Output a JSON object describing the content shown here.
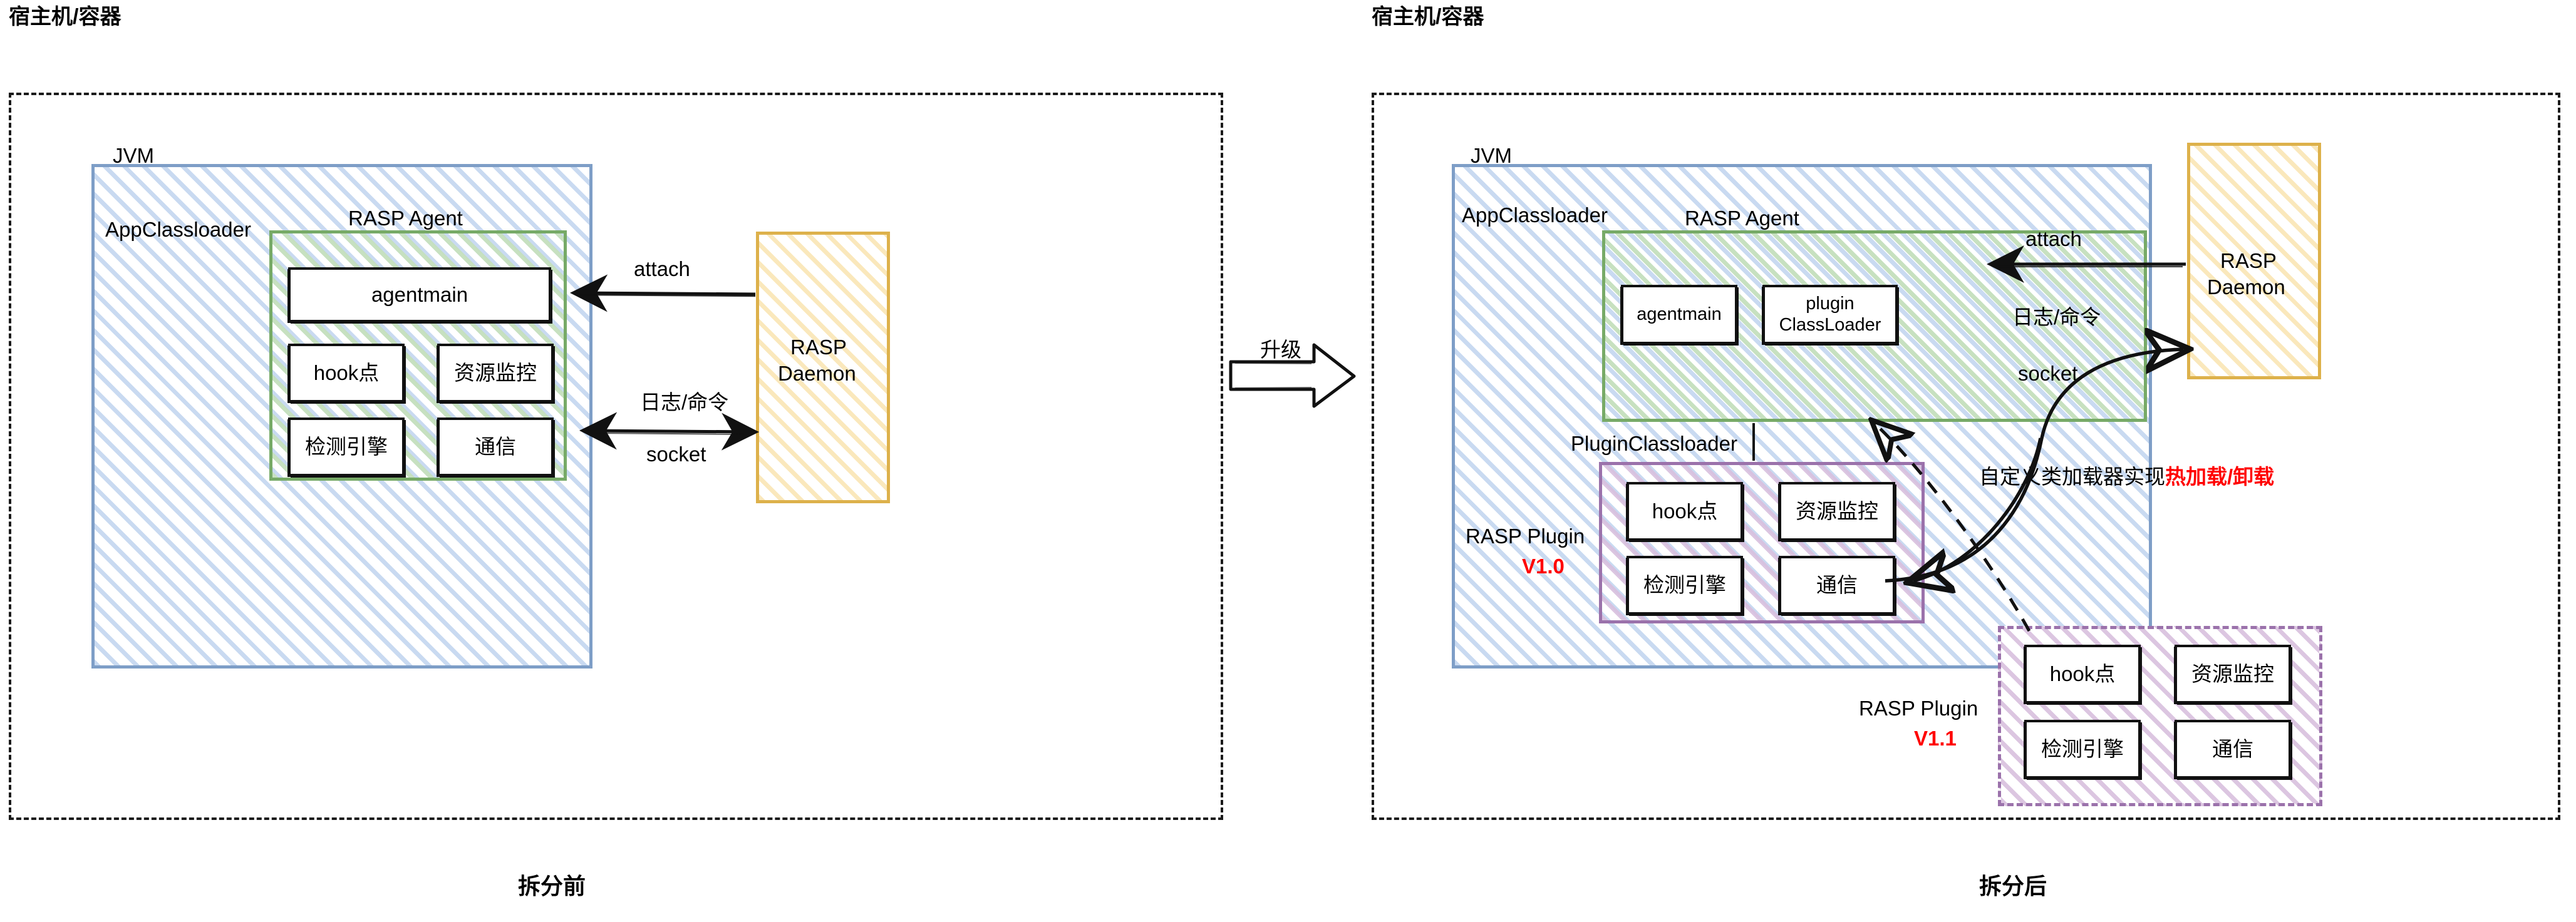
{
  "diagram": {
    "title_left": "宿主机/容器",
    "title_right": "宿主机/容器",
    "caption_left": "拆分前",
    "caption_right": "拆分后",
    "transition_label": "升级"
  },
  "left": {
    "host_label": "宿主机/容器",
    "jvm_label": "JVM",
    "appclassloader_label": "AppClassloader",
    "rasp_agent_label": "RASP Agent",
    "agent_nodes": [
      {
        "label": "agentmain"
      },
      {
        "label": "hook点"
      },
      {
        "label": "资源监控"
      },
      {
        "label": "检测引擎"
      },
      {
        "label": "通信"
      }
    ],
    "daemon_label": "RASP\nDaemon",
    "daemon_line1": "RASP",
    "daemon_line2": "Daemon",
    "arrow_attach": "attach",
    "arrow_log_cmd": "日志/命令",
    "arrow_socket": "socket",
    "caption": "拆分前"
  },
  "right": {
    "host_label": "宿主机/容器",
    "jvm_label": "JVM",
    "appclassloader_label": "AppClassloader",
    "rasp_agent_label": "RASP Agent",
    "agent_nodes": [
      {
        "label": "agentmain"
      },
      {
        "label": "plugin\nClassLoader",
        "line1": "plugin",
        "line2": "ClassLoader"
      }
    ],
    "pluginclassloader_label": "PluginClassloader",
    "plugin_v10_name": "RASP Plugin",
    "plugin_v10_version": "V1.0",
    "plugin_v10_nodes": [
      {
        "label": "hook点"
      },
      {
        "label": "资源监控"
      },
      {
        "label": "检测引擎"
      },
      {
        "label": "通信"
      }
    ],
    "plugin_v11_name": "RASP Plugin",
    "plugin_v11_version": "V1.1",
    "plugin_v11_nodes": [
      {
        "label": "hook点"
      },
      {
        "label": "资源监控"
      },
      {
        "label": "检测引擎"
      },
      {
        "label": "通信"
      }
    ],
    "daemon_line1": "RASP",
    "daemon_line2": "Daemon",
    "arrow_attach": "attach",
    "arrow_log_cmd": "日志/命令",
    "arrow_socket": "socket",
    "note_black": "自定义类加载器实现",
    "note_red": "热加载/卸载",
    "caption": "拆分后"
  },
  "colors": {
    "jvm_border": "#7e9ec7",
    "agent_border": "#77aa67",
    "plugin_border": "#9b72ab",
    "daemon_border": "#ddb14b",
    "highlight": "#ff0000",
    "ink": "#111111"
  }
}
